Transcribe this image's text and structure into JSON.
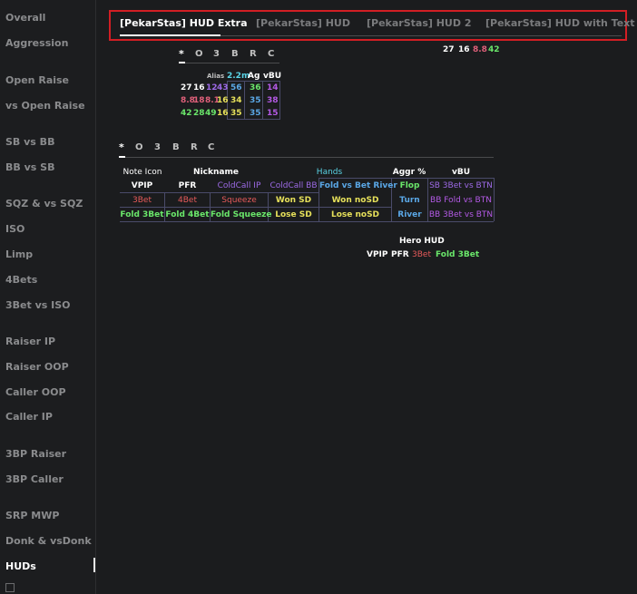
{
  "sidebar": {
    "items": [
      {
        "label": "Overall"
      },
      {
        "label": "Aggression"
      },
      {
        "label": "Open Raise"
      },
      {
        "label": "vs Open Raise"
      },
      {
        "label": "SB vs BB"
      },
      {
        "label": "BB vs SB"
      },
      {
        "label": "SQZ & vs SQZ"
      },
      {
        "label": "ISO"
      },
      {
        "label": "Limp"
      },
      {
        "label": "4Bets"
      },
      {
        "label": "3Bet vs ISO"
      },
      {
        "label": "Raiser IP"
      },
      {
        "label": "Raiser OOP"
      },
      {
        "label": "Caller OOP"
      },
      {
        "label": "Caller IP"
      },
      {
        "label": "3BP Raiser"
      },
      {
        "label": "3BP Caller"
      },
      {
        "label": "SRP MWP"
      },
      {
        "label": "Donk & vsDonk"
      },
      {
        "label": "HUDs"
      }
    ],
    "active": "HUDs"
  },
  "tabs": [
    {
      "label": "[PekarStas] HUD Extra"
    },
    {
      "label": "[PekarStas] HUD"
    },
    {
      "label": "[PekarStas] HUD 2"
    },
    {
      "label": "[PekarStas] HUD with Text"
    }
  ],
  "mini_hud": {
    "header": [
      "*",
      "O",
      "3",
      "B",
      "R",
      "C"
    ],
    "col_heads": [
      "Alias",
      "2.2m",
      "Ag",
      "vBU"
    ],
    "rows": [
      [
        "27",
        "16",
        "12",
        "43",
        "56",
        "36",
        "14"
      ],
      [
        "8.8",
        "18",
        "8.1",
        "16",
        "34",
        "35",
        "38"
      ],
      [
        "42",
        "28",
        "49",
        "16",
        "35",
        "35",
        "15"
      ]
    ]
  },
  "top_right": [
    "27",
    "16",
    "8.8",
    "42"
  ],
  "main_hud": {
    "header": [
      "*",
      "O",
      "3",
      "B",
      "R",
      "C"
    ],
    "row0": [
      "Note Icon",
      "Nickname",
      "Hands",
      "Aggr %",
      "vBU"
    ],
    "row1": [
      "VPIP",
      "PFR",
      "ColdCall IP",
      "ColdCall BB",
      "Fold vs Bet River",
      "Flop",
      "SB 3Bet vs BTN"
    ],
    "row2": [
      "3Bet",
      "4Bet",
      "Squeeze",
      "Won SD",
      "Won noSD",
      "Turn",
      "BB Fold vs BTN"
    ],
    "row3": [
      "Fold 3Bet",
      "Fold 4Bet",
      "Fold Squeeze",
      "Lose SD",
      "Lose noSD",
      "River",
      "BB 3Bet vs BTN"
    ]
  },
  "hero_hud": {
    "title": "Hero HUD",
    "items": [
      "VPIP",
      "PFR",
      "3Bet",
      "Fold 3Bet"
    ]
  }
}
